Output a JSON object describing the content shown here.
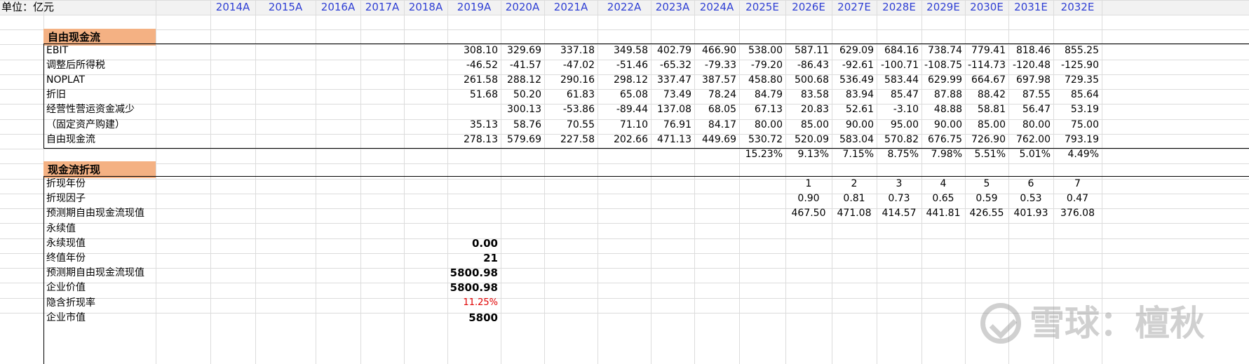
{
  "header": {
    "unit_label": "单位：亿元",
    "years": [
      "2014A",
      "2015A",
      "2016A",
      "2017A",
      "2018A",
      "2019A",
      "2020A",
      "2021A",
      "2022A",
      "2023A",
      "2024A",
      "2025E",
      "2026E",
      "2027E",
      "2028E",
      "2029E",
      "2030E",
      "2031E",
      "2032E"
    ]
  },
  "fcf_section": {
    "title": "自由现金流",
    "rows": [
      {
        "label": "EBIT",
        "values": [
          "",
          "",
          "",
          "",
          "",
          "308.10",
          "329.69",
          "337.18",
          "349.58",
          "402.79",
          "466.90",
          "538.00",
          "587.11",
          "629.09",
          "684.16",
          "738.74",
          "779.41",
          "818.46",
          "855.25"
        ]
      },
      {
        "label": "调整后所得税",
        "values": [
          "",
          "",
          "",
          "",
          "",
          "-46.52",
          "-41.57",
          "-47.02",
          "-51.46",
          "-65.32",
          "-79.33",
          "-79.20",
          "-86.43",
          "-92.61",
          "-100.71",
          "-108.75",
          "-114.73",
          "-120.48",
          "-125.90"
        ]
      },
      {
        "label": "NOPLAT",
        "values": [
          "",
          "",
          "",
          "",
          "",
          "261.58",
          "288.12",
          "290.16",
          "298.12",
          "337.47",
          "387.57",
          "458.80",
          "500.68",
          "536.49",
          "583.44",
          "629.99",
          "664.67",
          "697.98",
          "729.35"
        ]
      },
      {
        "label": "折旧",
        "values": [
          "",
          "",
          "",
          "",
          "",
          "51.68",
          "50.20",
          "61.83",
          "65.08",
          "73.49",
          "78.24",
          "84.79",
          "83.58",
          "83.94",
          "85.47",
          "87.88",
          "88.42",
          "87.55",
          "85.64"
        ]
      },
      {
        "label": "经营性营运资金减少",
        "values": [
          "",
          "",
          "",
          "",
          "",
          "",
          "300.13",
          "-53.86",
          "-89.44",
          "137.08",
          "68.05",
          "67.13",
          "20.83",
          "52.61",
          "-3.10",
          "48.88",
          "58.81",
          "56.47",
          "53.19"
        ]
      },
      {
        "label": "（固定资产购建）",
        "values": [
          "",
          "",
          "",
          "",
          "",
          "35.13",
          "58.76",
          "70.55",
          "71.10",
          "76.91",
          "84.17",
          "80.00",
          "85.00",
          "90.00",
          "95.00",
          "90.00",
          "85.00",
          "80.00",
          "75.00"
        ]
      },
      {
        "label": "自由现金流",
        "values": [
          "",
          "",
          "",
          "",
          "",
          "278.13",
          "579.69",
          "227.58",
          "202.66",
          "471.13",
          "449.69",
          "530.72",
          "520.09",
          "583.04",
          "570.82",
          "676.75",
          "726.90",
          "762.00",
          "793.19"
        ]
      }
    ],
    "growth_row": [
      "",
      "",
      "",
      "",
      "",
      "",
      "",
      "",
      "",
      "",
      "",
      "15.23%",
      "9.13%",
      "7.15%",
      "8.75%",
      "7.98%",
      "5.51%",
      "5.01%",
      "4.49%"
    ]
  },
  "dcf_section": {
    "title": "现金流折现",
    "rows": [
      {
        "label": "折现年份",
        "values": [
          "",
          "",
          "",
          "",
          "",
          "",
          "",
          "",
          "",
          "",
          "",
          "",
          "1",
          "2",
          "3",
          "4",
          "5",
          "6",
          "7"
        ]
      },
      {
        "label": "折现因子",
        "values": [
          "",
          "",
          "",
          "",
          "",
          "",
          "",
          "",
          "",
          "",
          "",
          "",
          "0.90",
          "0.81",
          "0.73",
          "0.65",
          "0.59",
          "0.53",
          "0.47"
        ]
      },
      {
        "label": "预测期自由现金流现值",
        "values": [
          "",
          "",
          "",
          "",
          "",
          "",
          "",
          "",
          "",
          "",
          "",
          "",
          "467.50",
          "471.08",
          "414.57",
          "441.81",
          "426.55",
          "401.93",
          "376.08"
        ]
      },
      {
        "label": "永续值",
        "values": []
      },
      {
        "label": "永续现值",
        "value2019": "0.00"
      },
      {
        "label": "终值年份",
        "value2019": "21"
      },
      {
        "label": "预测期自由现金流现值",
        "value2019": "5800.98"
      },
      {
        "label": "企业价值",
        "value2019": "5800.98"
      },
      {
        "label": "隐含折现率",
        "value2019": "11.25%",
        "color": "#e00000"
      },
      {
        "label": "企业市值",
        "value2019": "5800"
      }
    ]
  },
  "watermark": {
    "text": "雪球：檀秋",
    "icon": "snowball-logo-icon"
  }
}
